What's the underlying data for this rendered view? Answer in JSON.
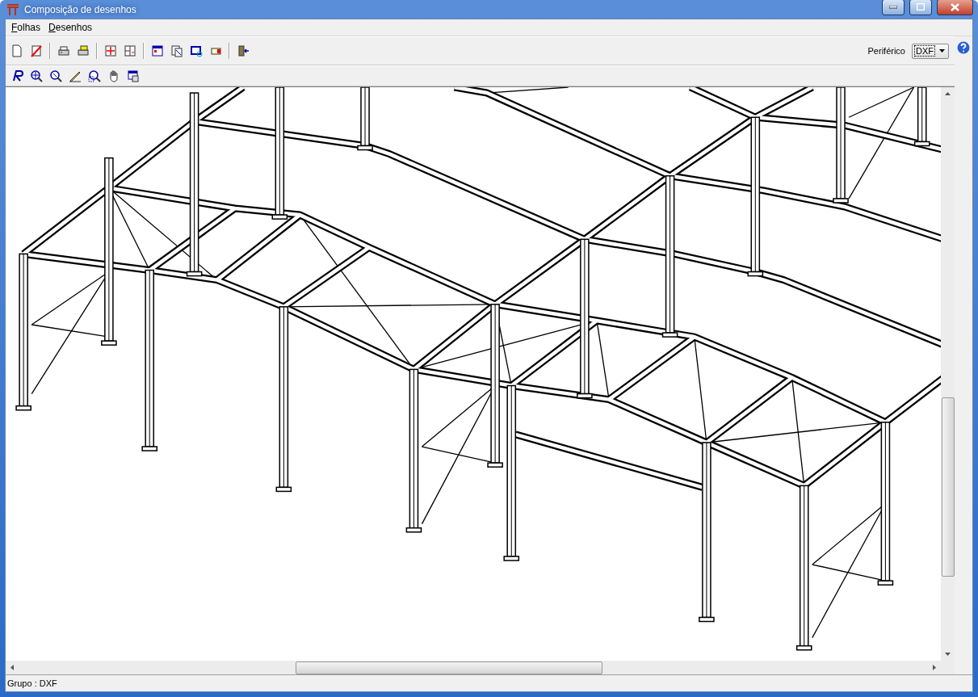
{
  "window": {
    "title": "Composição de desenhos"
  },
  "menu": [
    {
      "label": "Folhas"
    },
    {
      "label": "Desenhos"
    }
  ],
  "toolbar": {
    "device_label": "Periférico",
    "device_value": "DXF"
  },
  "status_bar": {
    "text": "Grupo : DXF"
  }
}
